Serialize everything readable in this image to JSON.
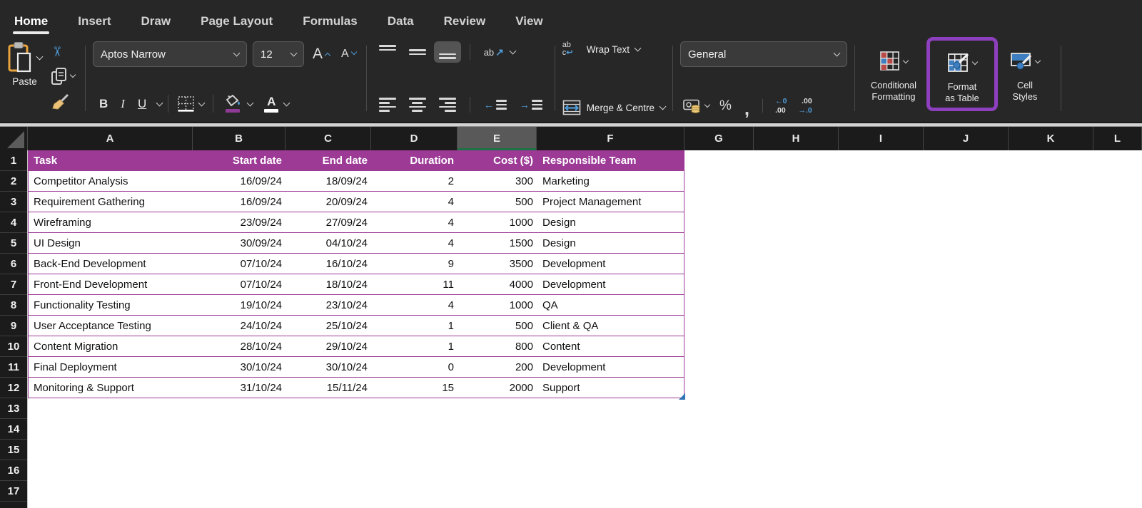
{
  "ribbon": {
    "tabs": [
      "Home",
      "Insert",
      "Draw",
      "Page Layout",
      "Formulas",
      "Data",
      "Review",
      "View"
    ],
    "active_tab": "Home"
  },
  "toolbar": {
    "paste_label": "Paste",
    "font_name": "Aptos Narrow",
    "font_size": "12",
    "grow_font": "A",
    "shrink_font": "A",
    "bold": "B",
    "italic": "I",
    "underline": "U",
    "font_color_letter": "A",
    "orientation_text": "ab",
    "orientation_arrow": "↗",
    "outdent_arrow": "←",
    "indent_arrow": "→",
    "wrap_icon_line1": "ab",
    "wrap_icon_line2": "c",
    "wrap_icon_return": "↩",
    "wrap_text_label": "Wrap Text",
    "merge_centre_label": "Merge & Centre",
    "number_format": "General",
    "percent": "%",
    "comma": ",",
    "increase_decimal_top": "←0",
    "increase_decimal_bottom": ".00",
    "decrease_decimal_top": ".00",
    "decrease_decimal_bottom": "→.0",
    "conditional_formatting_line1": "Conditional",
    "conditional_formatting_line2": "Formatting",
    "format_as_table_line1": "Format",
    "format_as_table_line2": "as Table",
    "cell_styles_line1": "Cell",
    "cell_styles_line2": "Styles"
  },
  "colors": {
    "table_header": "#9C3A96",
    "table_border": "#9C3A96",
    "annotation": "#8E3FBE",
    "selected_column_bg": "#595959",
    "selected_column_accent": "#1E7145",
    "fill_swatch": "#8E3A96",
    "font_color_swatch": "#FFFFFF"
  },
  "grid": {
    "column_headers": [
      "A",
      "B",
      "C",
      "D",
      "E",
      "F",
      "G",
      "H",
      "I",
      "J",
      "K",
      "L"
    ],
    "selected_column": "E",
    "row_numbers": [
      "1",
      "2",
      "3",
      "4",
      "5",
      "6",
      "7",
      "8",
      "9",
      "10",
      "11",
      "12",
      "13",
      "14",
      "15",
      "16",
      "17"
    ],
    "table": {
      "headers": [
        "Task",
        "Start date",
        "End date",
        "Duration",
        "Cost ($)",
        "Responsible Team"
      ],
      "rows": [
        [
          "Competitor Analysis",
          "16/09/24",
          "18/09/24",
          "2",
          "300",
          "Marketing"
        ],
        [
          "Requirement Gathering",
          "16/09/24",
          "20/09/24",
          "4",
          "500",
          "Project Management"
        ],
        [
          "Wireframing",
          "23/09/24",
          "27/09/24",
          "4",
          "1000",
          "Design"
        ],
        [
          "UI Design",
          "30/09/24",
          "04/10/24",
          "4",
          "1500",
          "Design"
        ],
        [
          "Back-End Development",
          "07/10/24",
          "16/10/24",
          "9",
          "3500",
          "Development"
        ],
        [
          "Front-End Development",
          "07/10/24",
          "18/10/24",
          "11",
          "4000",
          "Development"
        ],
        [
          "Functionality Testing",
          "19/10/24",
          "23/10/24",
          "4",
          "1000",
          "QA"
        ],
        [
          "User Acceptance Testing",
          "24/10/24",
          "25/10/24",
          "1",
          "500",
          "Client & QA"
        ],
        [
          "Content Migration",
          "28/10/24",
          "29/10/24",
          "1",
          "800",
          "Content"
        ],
        [
          "Final Deployment",
          "30/10/24",
          "30/10/24",
          "0",
          "200",
          "Development"
        ],
        [
          "Monitoring & Support",
          "31/10/24",
          "15/11/24",
          "15",
          "2000",
          "Support"
        ]
      ]
    }
  }
}
